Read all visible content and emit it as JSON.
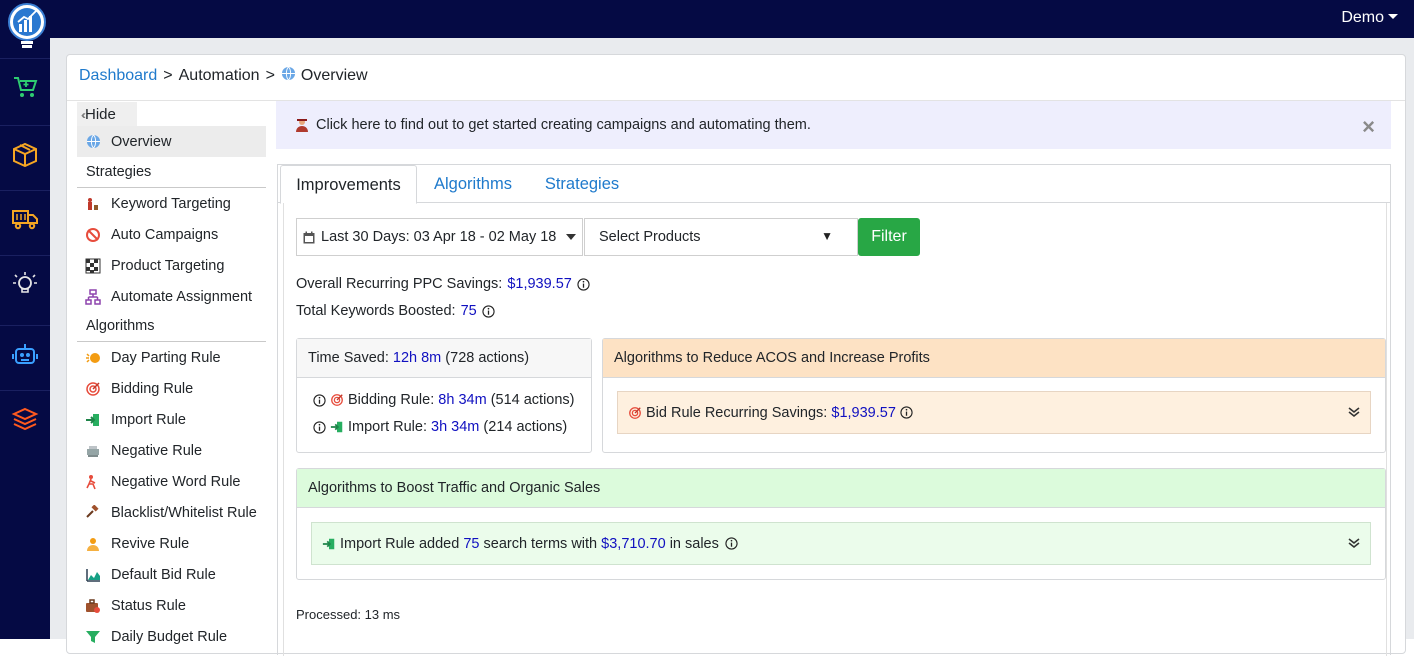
{
  "topbar": {
    "user_menu": "Demo"
  },
  "siderail": {
    "items": [
      {
        "icon": "cart-icon",
        "color": "#2ecc71"
      },
      {
        "icon": "box-icon",
        "color": "#f5a623"
      },
      {
        "icon": "truck-icon",
        "color": "#f5a623"
      },
      {
        "icon": "lightbulb-icon",
        "color": "#e6e6e6"
      },
      {
        "icon": "robot-icon",
        "color": "#3aa0ff"
      },
      {
        "icon": "layers-icon",
        "color": "#ff5a1f"
      }
    ]
  },
  "breadcrumb": {
    "home": "Dashboard",
    "section": "Automation",
    "current": "Overview",
    "separator": ">"
  },
  "leftmenu": {
    "hide_label": "Hide",
    "overview_label": "Overview",
    "strategies_header": "Strategies",
    "strategies": [
      {
        "label": "Keyword Targeting",
        "icon": "keyword-targeting-icon"
      },
      {
        "label": "Auto Campaigns",
        "icon": "auto-campaigns-icon"
      },
      {
        "label": "Product Targeting",
        "icon": "product-targeting-icon"
      },
      {
        "label": "Automate Assignment",
        "icon": "automate-assignment-icon"
      }
    ],
    "algorithms_header": "Algorithms",
    "algorithms": [
      {
        "label": "Day Parting Rule",
        "icon": "day-parting-icon"
      },
      {
        "label": "Bidding Rule",
        "icon": "bidding-rule-icon"
      },
      {
        "label": "Import Rule",
        "icon": "import-rule-icon"
      },
      {
        "label": "Negative Rule",
        "icon": "negative-rule-icon"
      },
      {
        "label": "Negative Word Rule",
        "icon": "negative-word-rule-icon"
      },
      {
        "label": "Blacklist/Whitelist Rule",
        "icon": "gavel-icon"
      },
      {
        "label": "Revive Rule",
        "icon": "revive-rule-icon"
      },
      {
        "label": "Default Bid Rule",
        "icon": "default-bid-icon"
      },
      {
        "label": "Status Rule",
        "icon": "status-rule-icon"
      },
      {
        "label": "Daily Budget Rule",
        "icon": "funnel-icon"
      }
    ]
  },
  "alert": {
    "text": "Click here to find out to get started creating campaigns and automating them.",
    "close": "×"
  },
  "tabs": [
    {
      "label": "Improvements"
    },
    {
      "label": "Algorithms"
    },
    {
      "label": "Strategies"
    }
  ],
  "filters": {
    "date_range": "Last 30 Days: 03 Apr 18 - 02 May 18",
    "products_placeholder": "Select Products",
    "products_arrow": "▼",
    "filter_button": "Filter"
  },
  "stats": {
    "ppc_savings_label": "Overall Recurring PPC Savings:",
    "ppc_savings_value": "$1,939.57",
    "keywords_label": "Total Keywords Boosted:",
    "keywords_value": "75"
  },
  "time_saved": {
    "label": "Time Saved:",
    "value": "12h 8m",
    "actions": "(728 actions)",
    "rows": [
      {
        "label": "Bidding Rule:",
        "value": "8h 34m",
        "actions": "(514 actions)"
      },
      {
        "label": "Import Rule:",
        "value": "3h 34m",
        "actions": "(214 actions)"
      }
    ]
  },
  "acos": {
    "header": "Algorithms to Reduce ACOS and Increase Profits",
    "item_label": "Bid Rule Recurring Savings:",
    "item_value": "$1,939.57"
  },
  "boost": {
    "header": "Algorithms to Boost Traffic and Organic Sales",
    "item_prefix": "Import Rule added",
    "item_count": "75",
    "item_middle": "search terms with",
    "item_sales": "$3,710.70",
    "item_suffix": "in sales"
  },
  "processed": "Processed: 13 ms"
}
